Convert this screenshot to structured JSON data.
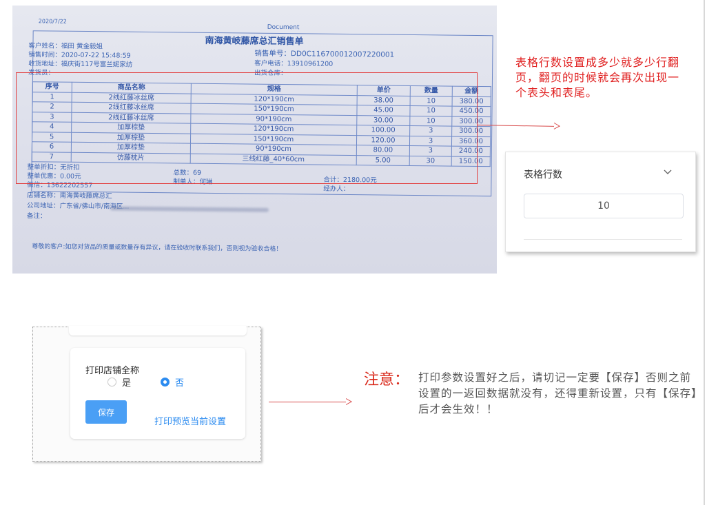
{
  "receipt": {
    "date": "2020/7/22",
    "doc_label": "Document",
    "title": "南海黄岐藤席总汇销售单",
    "customer_name": "客户姓名：福田 黄金毅姐",
    "sale_time": "销售时间：2020-07-22 15:48:59",
    "delivery_address": "收货地址：福庆街117号富兰妮家纺",
    "shipping_no": "发货员：",
    "order_no": "销售单号：DD0C11670001200722000​1",
    "customer_phone": "客户电话：1391096​1200",
    "warehouse": "出货仓库：",
    "columns": [
      "序号",
      "商品名称",
      "规格",
      "单价",
      "数量",
      "金额"
    ],
    "rows": [
      [
        "1",
        "2线红藤冰丝席",
        "120*190cm",
        "38.00",
        "10",
        "380.00"
      ],
      [
        "2",
        "2线红藤冰丝席",
        "150*190cm",
        "45.00",
        "10",
        "450.00"
      ],
      [
        "3",
        "2线红藤冰丝席",
        "90*190cm",
        "30.00",
        "10",
        "300.00"
      ],
      [
        "4",
        "加厚棕垫",
        "120*190cm",
        "100.00",
        "3",
        "300.00"
      ],
      [
        "5",
        "加厚棕垫",
        "150*190cm",
        "120.00",
        "3",
        "360.00"
      ],
      [
        "6",
        "加厚棕垫",
        "90*190cm",
        "80.00",
        "3",
        "240.00"
      ],
      [
        "7",
        "仿藤枕片",
        "三线红藤_40*60cm",
        "5.00",
        "30",
        "150.00"
      ]
    ],
    "discount": "整单折扣：无折扣",
    "offer": "整单优惠：0.00元",
    "wechat": "微信：13622202557",
    "shop_name": "店铺名称：南海黄岐藤席总汇",
    "shop_address": "公司地址：广东省/佛山市/南海区...",
    "remark": "备注：",
    "total_qty": "总数：69",
    "maker": "制单人：何琳",
    "total_amount": "合计：2180.00元",
    "handler": "经办人：",
    "notice": "尊敬的客户:如您对货品的质量或数量存有异议，请在验收时联系我们，否则视为验收合格！"
  },
  "row_note": "表格行数设置成多少就多少行翻页，翻页的时候就会再次出现一个表头和表尾。",
  "rows_panel": {
    "label": "表格行数",
    "value": "10"
  },
  "settings_panel": {
    "title": "打印店铺全称",
    "option_yes": "是",
    "option_no": "否",
    "selected": "否",
    "save_label": "保存",
    "preview_label": "打印预览当前设置"
  },
  "note": {
    "head": "注意：",
    "body": "打印参数设置好之后，请切记一定要【保存】否则之前设置的一返回数据就没有，还得重新设置，只有【保存】后才会生效！！"
  },
  "colors": {
    "annotation_red": "#e02020",
    "receipt_blue": "#3b63b3",
    "accent_blue": "#2d8cf0",
    "button_blue": "#4a9ff5"
  }
}
